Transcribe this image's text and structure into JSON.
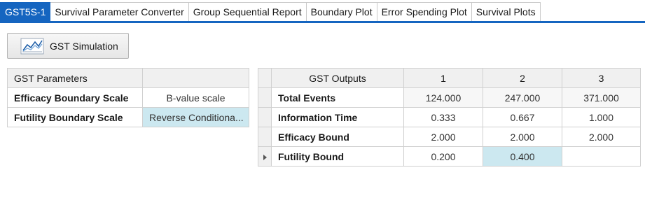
{
  "tabs": [
    {
      "label": "GST5S-1",
      "active": true
    },
    {
      "label": "Survival Parameter Converter",
      "active": false
    },
    {
      "label": "Group Sequential Report",
      "active": false
    },
    {
      "label": "Boundary Plot",
      "active": false
    },
    {
      "label": "Error Spending Plot",
      "active": false
    },
    {
      "label": "Survival Plots",
      "active": false
    }
  ],
  "toolbar": {
    "simulation_label": "GST Simulation",
    "simulation_icon": "line-chart-icon"
  },
  "params": {
    "header": "GST Parameters",
    "rows": [
      {
        "label": "Efficacy Boundary Scale",
        "value": "B-value scale"
      },
      {
        "label": "Futility Boundary Scale",
        "value": "Reverse Conditiona..."
      }
    ]
  },
  "outputs": {
    "header": "GST Outputs",
    "columns": [
      "1",
      "2",
      "3"
    ],
    "rows": [
      {
        "label": "Total Events",
        "values": [
          "124.000",
          "247.000",
          "371.000"
        ]
      },
      {
        "label": "Information Time",
        "values": [
          "0.333",
          "0.667",
          "1.000"
        ]
      },
      {
        "label": "Efficacy Bound",
        "values": [
          "2.000",
          "2.000",
          "2.000"
        ]
      },
      {
        "label": "Futility Bound",
        "values": [
          "0.200",
          "0.400",
          ""
        ]
      }
    ]
  },
  "colors": {
    "accent": "#1565c0",
    "selection": "#cce8f0"
  }
}
